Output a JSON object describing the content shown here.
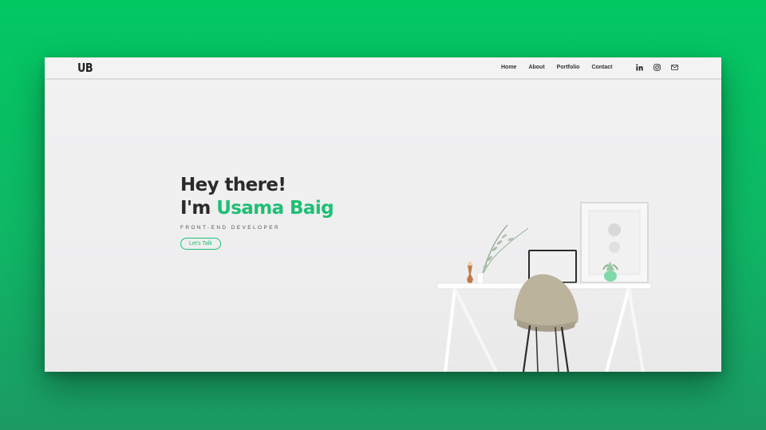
{
  "brand": {
    "logo_text": "UB"
  },
  "nav": {
    "items": [
      {
        "label": "Home"
      },
      {
        "label": "About"
      },
      {
        "label": "Portfolio"
      },
      {
        "label": "Contact"
      }
    ]
  },
  "social": {
    "icons": [
      "linkedin-icon",
      "instagram-icon",
      "mail-icon"
    ]
  },
  "hero": {
    "greeting": "Hey there!",
    "intro_prefix": "I'm",
    "name": "Usama Baig",
    "subtitle": "FRONT-END DEVELOPER",
    "cta_label": "Let's Talk"
  },
  "colors": {
    "accent": "#1dbf73",
    "frame_background": "#02c862",
    "text_dark": "#2a2a2a"
  }
}
